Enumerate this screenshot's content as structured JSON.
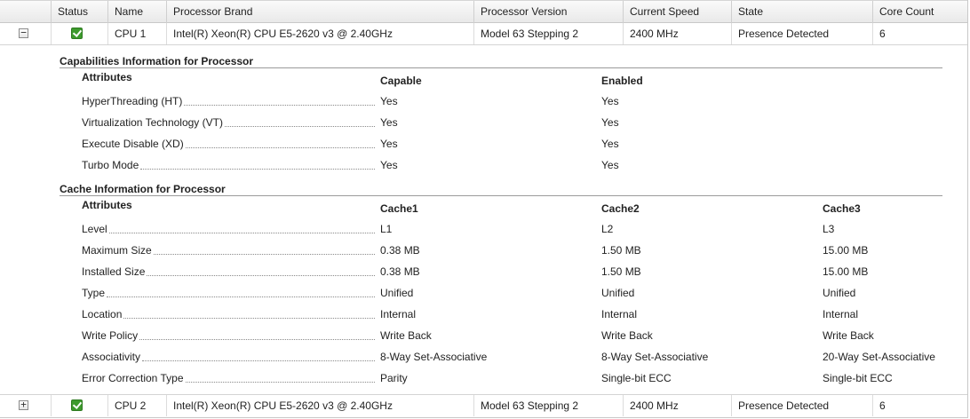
{
  "columns": [
    "Status",
    "Name",
    "Processor Brand",
    "Processor Version",
    "Current Speed",
    "State",
    "Core Count"
  ],
  "cpus": [
    {
      "toggle": "−",
      "name": "CPU 1",
      "brand": "Intel(R) Xeon(R) CPU E5-2620 v3 @ 2.40GHz",
      "version": "Model 63 Stepping 2",
      "speed": "2400 MHz",
      "state": "Presence Detected",
      "cores": "6"
    },
    {
      "toggle": "+",
      "name": "CPU 2",
      "brand": "Intel(R) Xeon(R) CPU E5-2620 v3 @ 2.40GHz",
      "version": "Model 63 Stepping 2",
      "speed": "2400 MHz",
      "state": "Presence Detected",
      "cores": "6"
    }
  ],
  "capabilities": {
    "title": "Capabilities Information for Processor",
    "attr_header": "Attributes",
    "columns": [
      "Capable",
      "Enabled"
    ],
    "rows": [
      {
        "label": "HyperThreading (HT)",
        "values": [
          "Yes",
          "Yes"
        ]
      },
      {
        "label": "Virtualization Technology (VT)",
        "values": [
          "Yes",
          "Yes"
        ]
      },
      {
        "label": "Execute Disable (XD)",
        "values": [
          "Yes",
          "Yes"
        ]
      },
      {
        "label": "Turbo Mode",
        "values": [
          "Yes",
          "Yes"
        ]
      }
    ]
  },
  "cache": {
    "title": "Cache Information for Processor",
    "attr_header": "Attributes",
    "columns": [
      "Cache1",
      "Cache2",
      "Cache3"
    ],
    "rows": [
      {
        "label": "Level",
        "values": [
          "L1",
          "L2",
          "L3"
        ]
      },
      {
        "label": "Maximum Size",
        "values": [
          "0.38 MB",
          "1.50 MB",
          "15.00 MB"
        ]
      },
      {
        "label": "Installed Size",
        "values": [
          "0.38 MB",
          "1.50 MB",
          "15.00 MB"
        ]
      },
      {
        "label": "Type",
        "values": [
          "Unified",
          "Unified",
          "Unified"
        ]
      },
      {
        "label": "Location",
        "values": [
          "Internal",
          "Internal",
          "Internal"
        ]
      },
      {
        "label": "Write Policy",
        "values": [
          "Write Back",
          "Write Back",
          "Write Back"
        ]
      },
      {
        "label": "Associativity",
        "values": [
          "8-Way Set-Associative",
          "8-Way Set-Associative",
          "20-Way Set-Associative"
        ]
      },
      {
        "label": "Error Correction Type",
        "values": [
          "Parity",
          "Single-bit ECC",
          "Single-bit ECC"
        ]
      }
    ]
  },
  "icons": {
    "status": "status-ok-check-icon",
    "status_color": "#3d9a2d"
  }
}
